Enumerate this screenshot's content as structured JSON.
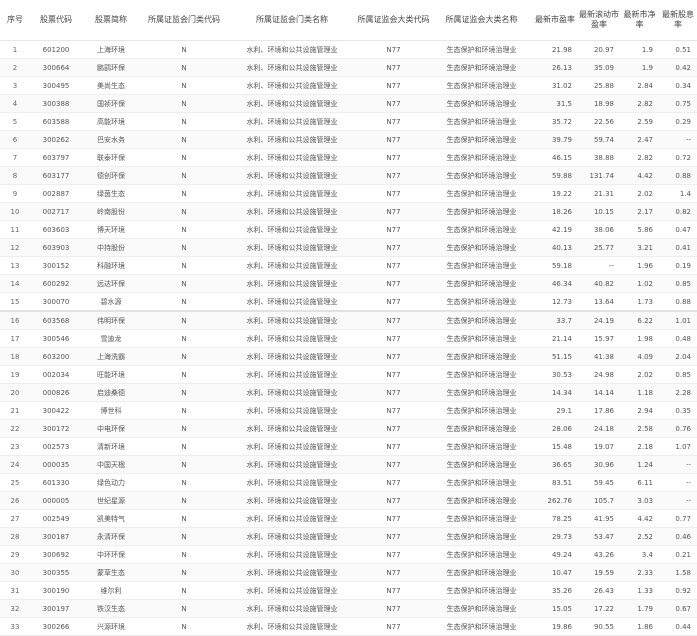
{
  "columns": [
    "序号",
    "股票代码",
    "股票简称",
    "所属证监会门类代码",
    "所属证监会门类名称",
    "所属证监会大类代码",
    "所属证监会大类名称",
    "最新市盈率",
    "最新滚动市盈率",
    "最新市净率",
    "最新股息率"
  ],
  "rows": [
    [
      "1",
      "601200",
      "上海环境",
      "N",
      "水利、环境和公共设施管理业",
      "N77",
      "生态保护和环境治理业",
      "21.98",
      "20.97",
      "1.9",
      "0.51"
    ],
    [
      "2",
      "300664",
      "鹏鹞环保",
      "N",
      "水利、环境和公共设施管理业",
      "N77",
      "生态保护和环境治理业",
      "26.13",
      "35.09",
      "1.9",
      "0.42"
    ],
    [
      "3",
      "300495",
      "美尚生态",
      "N",
      "水利、环境和公共设施管理业",
      "N77",
      "生态保护和环境治理业",
      "31.02",
      "25.88",
      "2.84",
      "0.34"
    ],
    [
      "4",
      "300388",
      "国祯环保",
      "N",
      "水利、环境和公共设施管理业",
      "N77",
      "生态保护和环境治理业",
      "31.5",
      "18.98",
      "2.82",
      "0.75"
    ],
    [
      "5",
      "603588",
      "高能环境",
      "N",
      "水利、环境和公共设施管理业",
      "N77",
      "生态保护和环境治理业",
      "35.72",
      "22.56",
      "2.59",
      "0.29"
    ],
    [
      "6",
      "300262",
      "巴安水务",
      "N",
      "水利、环境和公共设施管理业",
      "N77",
      "生态保护和环境治理业",
      "39.79",
      "59.74",
      "2.47",
      "--"
    ],
    [
      "7",
      "603797",
      "联泰环保",
      "N",
      "水利、环境和公共设施管理业",
      "N77",
      "生态保护和环境治理业",
      "46.15",
      "38.88",
      "2.82",
      "0.72"
    ],
    [
      "8",
      "603177",
      "德创环保",
      "N",
      "水利、环境和公共设施管理业",
      "N77",
      "生态保护和环境治理业",
      "59.88",
      "131.74",
      "4.42",
      "0.88"
    ],
    [
      "9",
      "002887",
      "绿茵生态",
      "N",
      "水利、环境和公共设施管理业",
      "N77",
      "生态保护和环境治理业",
      "19.22",
      "21.31",
      "2.02",
      "1.4"
    ],
    [
      "10",
      "002717",
      "岭南股份",
      "N",
      "水利、环境和公共设施管理业",
      "N77",
      "生态保护和环境治理业",
      "18.26",
      "10.15",
      "2.17",
      "0.82"
    ],
    [
      "11",
      "603603",
      "博天环境",
      "N",
      "水利、环境和公共设施管理业",
      "N77",
      "生态保护和环境治理业",
      "42.19",
      "38.06",
      "5.86",
      "0.47"
    ],
    [
      "12",
      "603903",
      "中持股份",
      "N",
      "水利、环境和公共设施管理业",
      "N77",
      "生态保护和环境治理业",
      "40.13",
      "25.77",
      "3.21",
      "0.41"
    ],
    [
      "13",
      "300152",
      "科融环境",
      "N",
      "水利、环境和公共设施管理业",
      "N77",
      "生态保护和环境治理业",
      "59.18",
      "--",
      "1.96",
      "0.19"
    ],
    [
      "14",
      "600292",
      "远达环保",
      "N",
      "水利、环境和公共设施管理业",
      "N77",
      "生态保护和环境治理业",
      "46.34",
      "40.82",
      "1.02",
      "0.85"
    ],
    [
      "15",
      "300070",
      "碧水源",
      "N",
      "水利、环境和公共设施管理业",
      "N77",
      "生态保护和环境治理业",
      "12.73",
      "13.64",
      "1.73",
      "0.88"
    ],
    [
      "16",
      "603568",
      "伟明环保",
      "N",
      "水利、环境和公共设施管理业",
      "N77",
      "生态保护和环境治理业",
      "33.7",
      "24.19",
      "6.22",
      "1.01"
    ],
    [
      "17",
      "300546",
      "雪迪龙",
      "N",
      "水利、环境和公共设施管理业",
      "N77",
      "生态保护和环境治理业",
      "21.14",
      "15.97",
      "1.98",
      "0.48"
    ],
    [
      "18",
      "603200",
      "上海洗霸",
      "N",
      "水利、环境和公共设施管理业",
      "N77",
      "生态保护和环境治理业",
      "51.15",
      "41.38",
      "4.09",
      "2.04"
    ],
    [
      "19",
      "002034",
      "旺能环境",
      "N",
      "水利、环境和公共设施管理业",
      "N77",
      "生态保护和环境治理业",
      "30.53",
      "24.98",
      "2.02",
      "0.85"
    ],
    [
      "20",
      "000826",
      "启迪桑德",
      "N",
      "水利、环境和公共设施管理业",
      "N77",
      "生态保护和环境治理业",
      "14.34",
      "14.14",
      "1.18",
      "2.28"
    ],
    [
      "21",
      "300422",
      "博世科",
      "N",
      "水利、环境和公共设施管理业",
      "N77",
      "生态保护和环境治理业",
      "29.1",
      "17.86",
      "2.94",
      "0.35"
    ],
    [
      "22",
      "300172",
      "中电环保",
      "N",
      "水利、环境和公共设施管理业",
      "N77",
      "生态保护和环境治理业",
      "28.06",
      "24.18",
      "2.58",
      "0.76"
    ],
    [
      "23",
      "002573",
      "清新环境",
      "N",
      "水利、环境和公共设施管理业",
      "N77",
      "生态保护和环境治理业",
      "15.48",
      "19.07",
      "2.18",
      "1.07"
    ],
    [
      "24",
      "000035",
      "中国天楹",
      "N",
      "水利、环境和公共设施管理业",
      "N77",
      "生态保护和环境治理业",
      "36.65",
      "30.96",
      "1.24",
      "--"
    ],
    [
      "25",
      "601330",
      "绿色动力",
      "N",
      "水利、环境和公共设施管理业",
      "N77",
      "生态保护和环境治理业",
      "83.51",
      "59.45",
      "6.11",
      "--"
    ],
    [
      "26",
      "000005",
      "世纪星源",
      "N",
      "水利、环境和公共设施管理业",
      "N77",
      "生态保护和环境治理业",
      "262.76",
      "105.7",
      "3.03",
      "--"
    ],
    [
      "27",
      "002549",
      "凯美特气",
      "N",
      "水利、环境和公共设施管理业",
      "N77",
      "生态保护和环境治理业",
      "78.25",
      "41.95",
      "4.42",
      "0.77"
    ],
    [
      "28",
      "300187",
      "永清环保",
      "N",
      "水利、环境和公共设施管理业",
      "N77",
      "生态保护和环境治理业",
      "29.73",
      "53.47",
      "2.52",
      "0.46"
    ],
    [
      "29",
      "300692",
      "中环环保",
      "N",
      "水利、环境和公共设施管理业",
      "N77",
      "生态保护和环境治理业",
      "49.24",
      "43.26",
      "3.4",
      "0.21"
    ],
    [
      "30",
      "300355",
      "蒙草生态",
      "N",
      "水利、环境和公共设施管理业",
      "N77",
      "生态保护和环境治理业",
      "10.47",
      "19.59",
      "2.33",
      "1.58"
    ],
    [
      "31",
      "300190",
      "维尔利",
      "N",
      "水利、环境和公共设施管理业",
      "N77",
      "生态保护和环境治理业",
      "35.26",
      "26.43",
      "1.33",
      "0.92"
    ],
    [
      "32",
      "300197",
      "铁汉生态",
      "N",
      "水利、环境和公共设施管理业",
      "N77",
      "生态保护和环境治理业",
      "15.05",
      "17.22",
      "1.79",
      "0.67"
    ],
    [
      "33",
      "300266",
      "兴源环境",
      "N",
      "水利、环境和公共设施管理业",
      "N77",
      "生态保护和环境治理业",
      "19.86",
      "90.55",
      "1.86",
      "0.44"
    ]
  ]
}
